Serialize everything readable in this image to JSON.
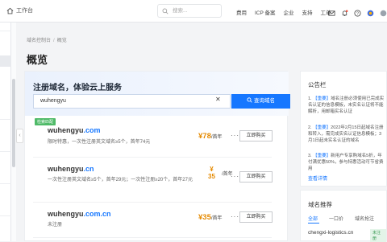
{
  "topbar": {
    "home_label": "工作台",
    "search_placeholder": "搜索...",
    "menu": [
      "费用",
      "ICP 备案",
      "企业",
      "支持",
      "工单"
    ]
  },
  "breadcrumb": {
    "root": "域名控制台",
    "current": "概览"
  },
  "page_title": "概览",
  "register": {
    "heading": "注册域名，体验云上服务",
    "query": "wuhengyu",
    "search_button": "查询域名"
  },
  "results": [
    {
      "badge": "检索匹配",
      "name": "wuhengyu",
      "tld": ".com",
      "desc": "限时特惠，一次性注册英文域名≥5个，首年74元",
      "price": "¥78",
      "unit": "/首年",
      "buy": "立即购买"
    },
    {
      "name": "wuhengyu",
      "tld": ".cn",
      "desc": "一次性注册英文域名≥5个，首年29元；一次性注册≥20个，首年27元",
      "price_symbol": "¥",
      "price": "35",
      "unit": "/首年",
      "buy": "立即购买"
    },
    {
      "name": "wuhengyu",
      "tld": ".com.cn",
      "desc": "未注册",
      "price": "¥35",
      "unit": "/首年",
      "buy": "立即购买"
    }
  ],
  "announcements": {
    "title": "公告栏",
    "items": [
      {
        "tag": "【重要】",
        "text": "域名注册必须使用已完成实名认证的信息模板，未实名认证将不能解析，用邮箱实名认证"
      },
      {
        "tag": "【重要】",
        "text": "2022年2月15日起域名注册和转入，需完成实名认证信息模板；3月1日起未实名认证的域名"
      },
      {
        "tag": "【重要】",
        "text": "新用户专享购域名5折，年付满优惠50%，参与特惠活动可节省费用"
      }
    ],
    "more": "查看详情"
  },
  "recommend": {
    "title": "域名推荐",
    "tabs": [
      "全部",
      "一口价",
      "域名抢注"
    ],
    "domain": "chengxi-logistics.cn",
    "badge": "未注册"
  },
  "colors": {
    "accent": "#1677ff",
    "price": "#e58a00",
    "badge": "#4fba68"
  }
}
